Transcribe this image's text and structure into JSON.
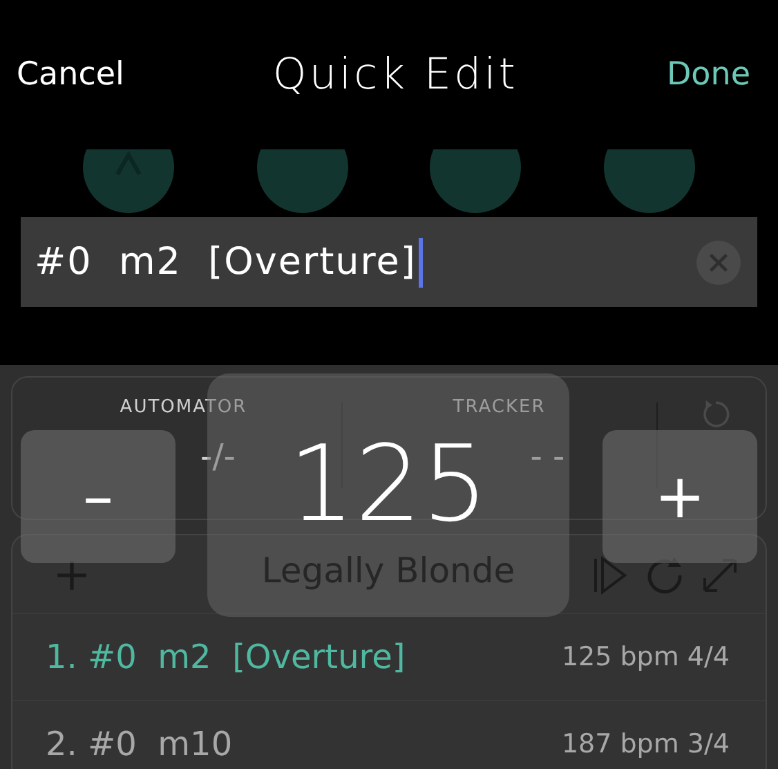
{
  "header": {
    "cancel": "Cancel",
    "title": "Quick Edit",
    "done": "Done"
  },
  "circles": [
    {
      "kind": "caret"
    },
    {
      "kind": "plain"
    },
    {
      "kind": "plain"
    },
    {
      "kind": "plain"
    }
  ],
  "name_field": {
    "value": "#0  m2  [Overture]"
  },
  "panel": {
    "automator": {
      "label": "AUTOMATOR",
      "value": "-/-"
    },
    "tracker": {
      "label": "TRACKER",
      "value": "- -"
    }
  },
  "songs": [
    {
      "title": "1. #0  m2  [Overture]",
      "meta": "125 bpm 4/4",
      "selected": true
    },
    {
      "title": "2. #0  m10",
      "meta": "187 bpm 3/4",
      "selected": false
    }
  ],
  "tempo": {
    "minus": "–",
    "value": "125",
    "plus": "+",
    "song": "Legally Blonde"
  }
}
